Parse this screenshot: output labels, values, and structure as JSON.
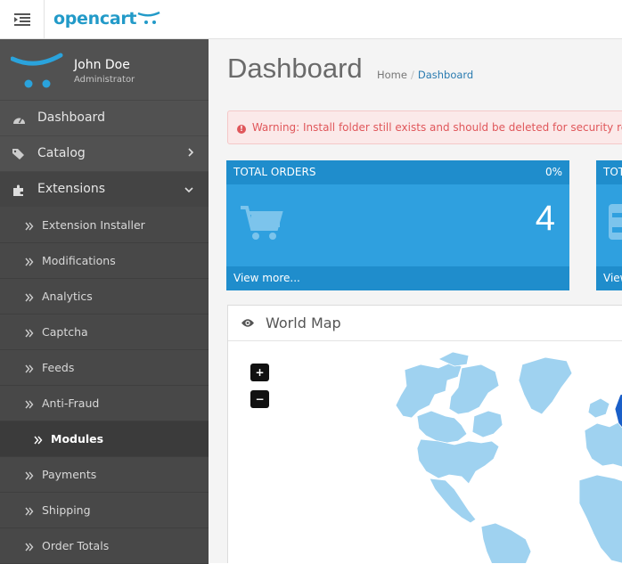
{
  "header": {
    "logo_text": "opencart"
  },
  "profile": {
    "name": "John Doe",
    "role": "Administrator"
  },
  "sidebar": {
    "items": [
      {
        "label": "Dashboard",
        "icon": "dashboard-icon"
      },
      {
        "label": "Catalog",
        "icon": "tags-icon"
      },
      {
        "label": "Extensions",
        "icon": "puzzle-icon"
      }
    ],
    "extensions_sub": [
      {
        "label": "Extension Installer"
      },
      {
        "label": "Modifications"
      },
      {
        "label": "Analytics"
      },
      {
        "label": "Captcha"
      },
      {
        "label": "Feeds"
      },
      {
        "label": "Anti-Fraud"
      },
      {
        "label": "Modules"
      },
      {
        "label": "Payments"
      },
      {
        "label": "Shipping"
      },
      {
        "label": "Order Totals"
      }
    ]
  },
  "main": {
    "title": "Dashboard",
    "breadcrumb": [
      "Home",
      "Dashboard"
    ],
    "alert": "Warning: Install folder still exists and should be deleted for security reasons!",
    "tiles": [
      {
        "title": "TOTAL ORDERS",
        "percent": "0%",
        "value": "4",
        "footer": "View more..."
      },
      {
        "title": "TOTAL SALES",
        "percent": "",
        "value": "",
        "footer": "View more..."
      }
    ],
    "map_panel": {
      "title": "World Map",
      "zoom_in": "+",
      "zoom_out": "−"
    }
  },
  "colors": {
    "brand": "#229ac8",
    "sidebar_bg": "#515151",
    "tile_bg": "#2fa0df",
    "tile_band": "#1f8dcc",
    "alert_text": "#e0575b",
    "map_land": "#9fd2f0",
    "map_highlight": "#1a5fc8"
  }
}
